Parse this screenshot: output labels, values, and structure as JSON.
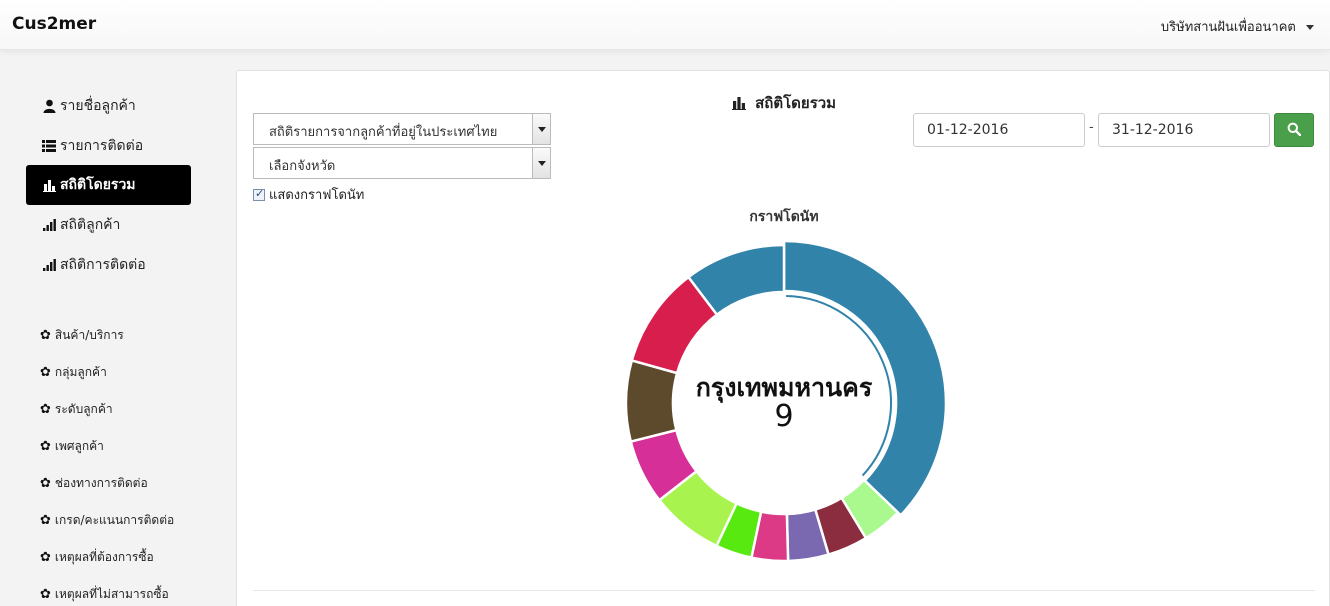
{
  "header": {
    "brand": "Cus2mer",
    "company": "บริษัทสานฝันเพื่ออนาคต"
  },
  "sidebar": {
    "main_items": [
      {
        "label": "รายชื่อลูกค้า",
        "icon": "user-icon"
      },
      {
        "label": "รายการติดต่อ",
        "icon": "list-icon"
      },
      {
        "label": "สถิติโดยรวม",
        "icon": "bar-chart-icon",
        "active": true
      },
      {
        "label": "สถิติลูกค้า",
        "icon": "signal-icon"
      },
      {
        "label": "สถิติการติดต่อ",
        "icon": "signal-icon"
      }
    ],
    "settings_items": [
      {
        "label": "สินค้า/บริการ",
        "icon": "gear-icon"
      },
      {
        "label": "กลุ่มลูกค้า",
        "icon": "gear-icon"
      },
      {
        "label": "ระดับลูกค้า",
        "icon": "gear-icon"
      },
      {
        "label": "เพศลูกค้า",
        "icon": "gear-icon"
      },
      {
        "label": "ช่องทางการติดต่อ",
        "icon": "gear-icon"
      },
      {
        "label": "เกรด/คะแนนการติดต่อ",
        "icon": "gear-icon"
      },
      {
        "label": "เหตุผลที่ต้องการซื้อ",
        "icon": "gear-icon"
      },
      {
        "label": "เหตุผลที่ไม่สามารถซื้อ",
        "icon": "gear-icon"
      }
    ]
  },
  "panel": {
    "title": "สถิติโดยรวม",
    "report_select": "สถิติรายการจากลูกค้าที่อยู่ในประเทศไทย",
    "province_select": "เลือกจังหวัด",
    "show_donut_label": "แสดงกราฟโดนัท",
    "show_donut_checked": true,
    "date_from": "01-12-2016",
    "date_to": "31-12-2016",
    "date_separator": "-",
    "chart_title": "กราฟโดนัท",
    "center_label": "กรุงเทพมหานคร",
    "center_value": "9"
  },
  "colors": {
    "active_nav": "#000000",
    "search_button": "#4aa04a"
  },
  "chart_data": {
    "type": "pie",
    "donut": true,
    "title": "กราฟโดนัท",
    "highlighted_slice": {
      "label": "กรุงเทพมหานคร",
      "value": 9
    },
    "values": [
      9,
      1,
      1,
      1,
      0.9,
      0.9,
      1.8,
      1.6,
      2.0,
      2.5,
      2.5
    ],
    "colors": [
      "#3183aa",
      "#a9f98f",
      "#8b2c3f",
      "#7a68b1",
      "#dc3a86",
      "#58ea10",
      "#a9f34e",
      "#d62f97",
      "#5d4a2d",
      "#d71e4c"
    ]
  }
}
